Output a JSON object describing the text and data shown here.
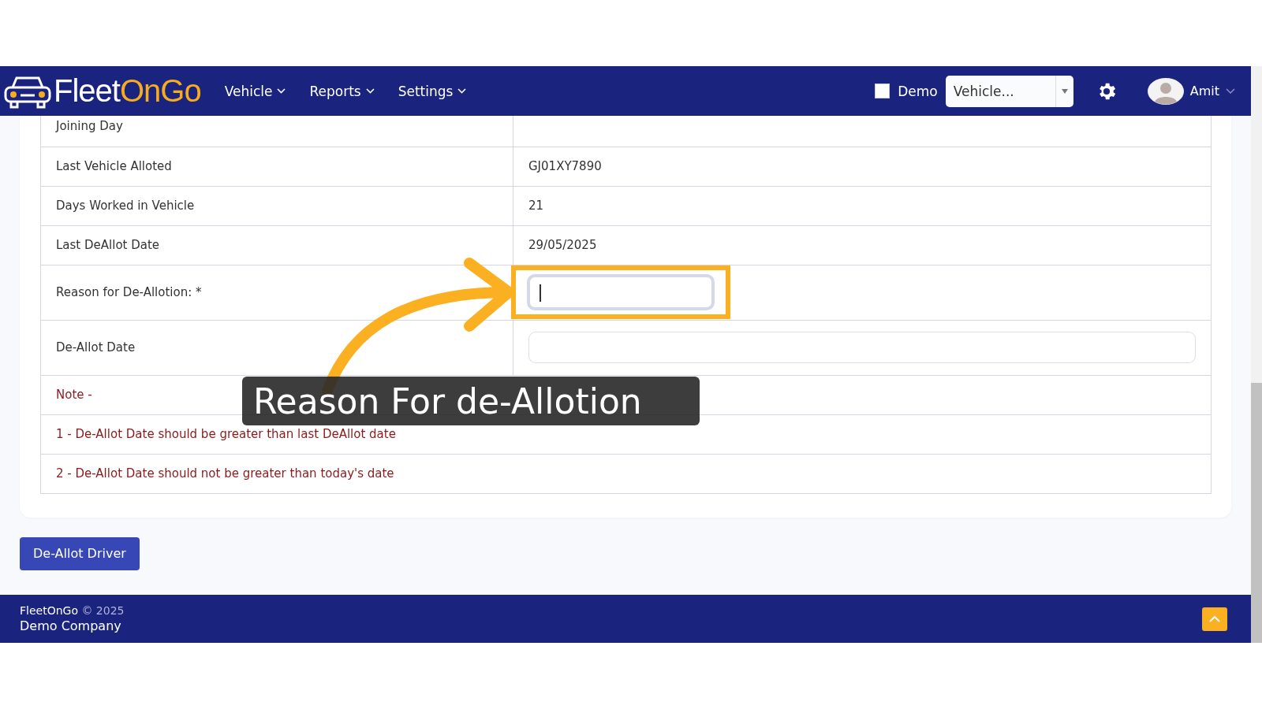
{
  "navbar": {
    "brand": [
      {
        "text": "Fleet",
        "color": "#ffffff"
      },
      {
        "text": "OnGo",
        "color": "#f7ab1e"
      }
    ],
    "menus": [
      {
        "label": "Vehicle"
      },
      {
        "label": "Reports"
      },
      {
        "label": "Settings"
      }
    ],
    "demo": {
      "label": "Demo",
      "checked": false
    },
    "vehicle_select": {
      "value": "Vehicle..."
    },
    "user": {
      "name": "Amit"
    }
  },
  "details": [
    {
      "kind": "text",
      "label": "Joining Day"
    },
    {
      "kind": "text",
      "label": "Last Vehicle Alloted",
      "value": "GJ01XY7890"
    },
    {
      "kind": "text",
      "label": "Days Worked in Vehicle",
      "value": "21"
    },
    {
      "kind": "text",
      "label": "Last DeAllot Date",
      "value": "29/05/2025"
    },
    {
      "kind": "input",
      "label": "Reason for De-Allotion: *",
      "focused": true,
      "highlighted": true
    },
    {
      "kind": "input",
      "label": "De-Allot Date",
      "focused": false,
      "highlighted": false
    }
  ],
  "notes": [
    "Note -",
    "1 - De-Allot Date should be greater than last DeAllot date",
    "2 - De-Allot Date should not be greater than today's date"
  ],
  "submit_button": "De-Allot Driver",
  "footer": {
    "brand": "FleetOnGo",
    "copyright": "© 2025",
    "company": "Demo Company"
  },
  "callout": {
    "text": "Reason For de-Allotion"
  }
}
